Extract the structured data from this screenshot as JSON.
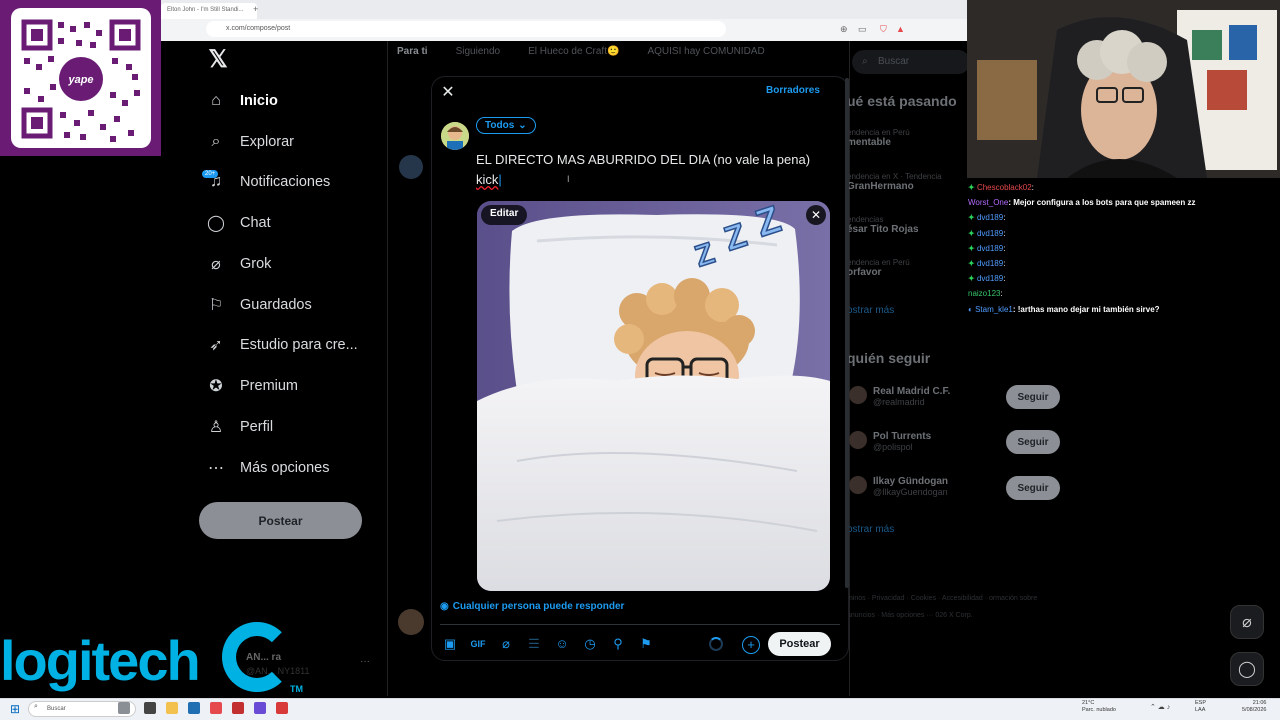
{
  "browser": {
    "tab_title": "Elton John - I'm Still Standi...",
    "new_tab": "+",
    "url": "x.com/compose/post"
  },
  "x_nav": {
    "items": [
      {
        "label": "Inicio",
        "icon": "home-icon"
      },
      {
        "label": "Explorar",
        "icon": "search-icon"
      },
      {
        "label": "Notificaciones",
        "icon": "bell-icon"
      },
      {
        "label": "Chat",
        "icon": "chat-icon"
      },
      {
        "label": "Grok",
        "icon": "grok-icon"
      },
      {
        "label": "Guardados",
        "icon": "bookmark-icon"
      },
      {
        "label": "Estudio para cre...",
        "icon": "rocket-icon"
      },
      {
        "label": "Premium",
        "icon": "verified-icon"
      },
      {
        "label": "Perfil",
        "icon": "person-icon"
      },
      {
        "label": "Más opciones",
        "icon": "more-circle-icon"
      }
    ],
    "notif_badge": "20+",
    "post_button": "Postear",
    "account_name": "AN... ra",
    "account_handle": "@AN... NY1811"
  },
  "timeline": {
    "tabs": [
      "Para ti",
      "Siguiendo",
      "El Hueco de Craft🙂",
      "AQUISI hay COMUNIDAD"
    ]
  },
  "right_panel": {
    "search_placeholder": "Buscar",
    "trends_title": "ué está pasando",
    "trends": [
      {
        "sub": "endencia en Perú",
        "main": "mentable"
      },
      {
        "sub": "endencia en X · Tendencia",
        "main": "GranHermano"
      },
      {
        "sub": "endencias",
        "main": "ésar Tito Rojas"
      },
      {
        "sub": "endencia en Perú",
        "main": "orfavor"
      }
    ],
    "show_more": "ostrar más",
    "follow_title": "quién seguir",
    "follow": [
      {
        "name": "Real Madrid C.F.",
        "handle": "@realmadrid",
        "button": "Seguir"
      },
      {
        "name": "Pol Turrents",
        "handle": "@polispol",
        "button": "Seguir"
      },
      {
        "name": "Ilkay Gündogan",
        "handle": "@IlkayGuendogan",
        "button": "Seguir"
      }
    ],
    "show_more_2": "ostrar más",
    "footer": "minos · Privacidad · Cookies · Accesibilidad · ormación sobre anuncios · Más opciones ··· 026 X Corp."
  },
  "compose": {
    "close": "✕",
    "drafts": "Borradores",
    "audience": "Todos",
    "text_line1": "EL DIRECTO MAS ABURRIDO DEL DIA (no vale la pena)",
    "text_line2": "kick",
    "edit_label": "Editar",
    "reply_setting": "Cualquier persona puede responder",
    "post_button": "Postear",
    "tools": [
      "image-icon",
      "gif-icon",
      "grok-icon",
      "poll-icon",
      "emoji-icon",
      "schedule-icon",
      "location-icon",
      "flag-icon"
    ]
  },
  "chat": [
    {
      "user": "Chescoblack02",
      "color": "#e5484d",
      "msg": ":"
    },
    {
      "user": "Worst_One",
      "color": "#b36bff",
      "msg": ": Mejor configura a los bots para que spameen zz"
    },
    {
      "user": "dvd189",
      "color": "#4f9cff",
      "msg": ":"
    },
    {
      "user": "dvd189",
      "color": "#4f9cff",
      "msg": ":"
    },
    {
      "user": "dvd189",
      "color": "#4f9cff",
      "msg": ":"
    },
    {
      "user": "dvd189",
      "color": "#4f9cff",
      "msg": ":"
    },
    {
      "user": "dvd189",
      "color": "#4f9cff",
      "msg": ":"
    },
    {
      "user": "naizo123",
      "color": "#35c46a",
      "msg": ":"
    },
    {
      "user": "Stam_kle1",
      "color": "#4f9cff",
      "msg": ": !arthas mano dejar mi   también sirve?"
    }
  ],
  "overlay": {
    "logitech": "logitech",
    "tm": "TM"
  },
  "taskbar": {
    "search": "Buscar",
    "weather_temp": "21°C",
    "weather_desc": "Parc. nublado",
    "lang1": "ESP",
    "lang2": "LAA",
    "time": "21:06",
    "date": "5/08/2026"
  },
  "colors": {
    "accent": "#1d9bf0",
    "qr_bg": "#6a1b74",
    "logitech": "#00b2e3"
  }
}
